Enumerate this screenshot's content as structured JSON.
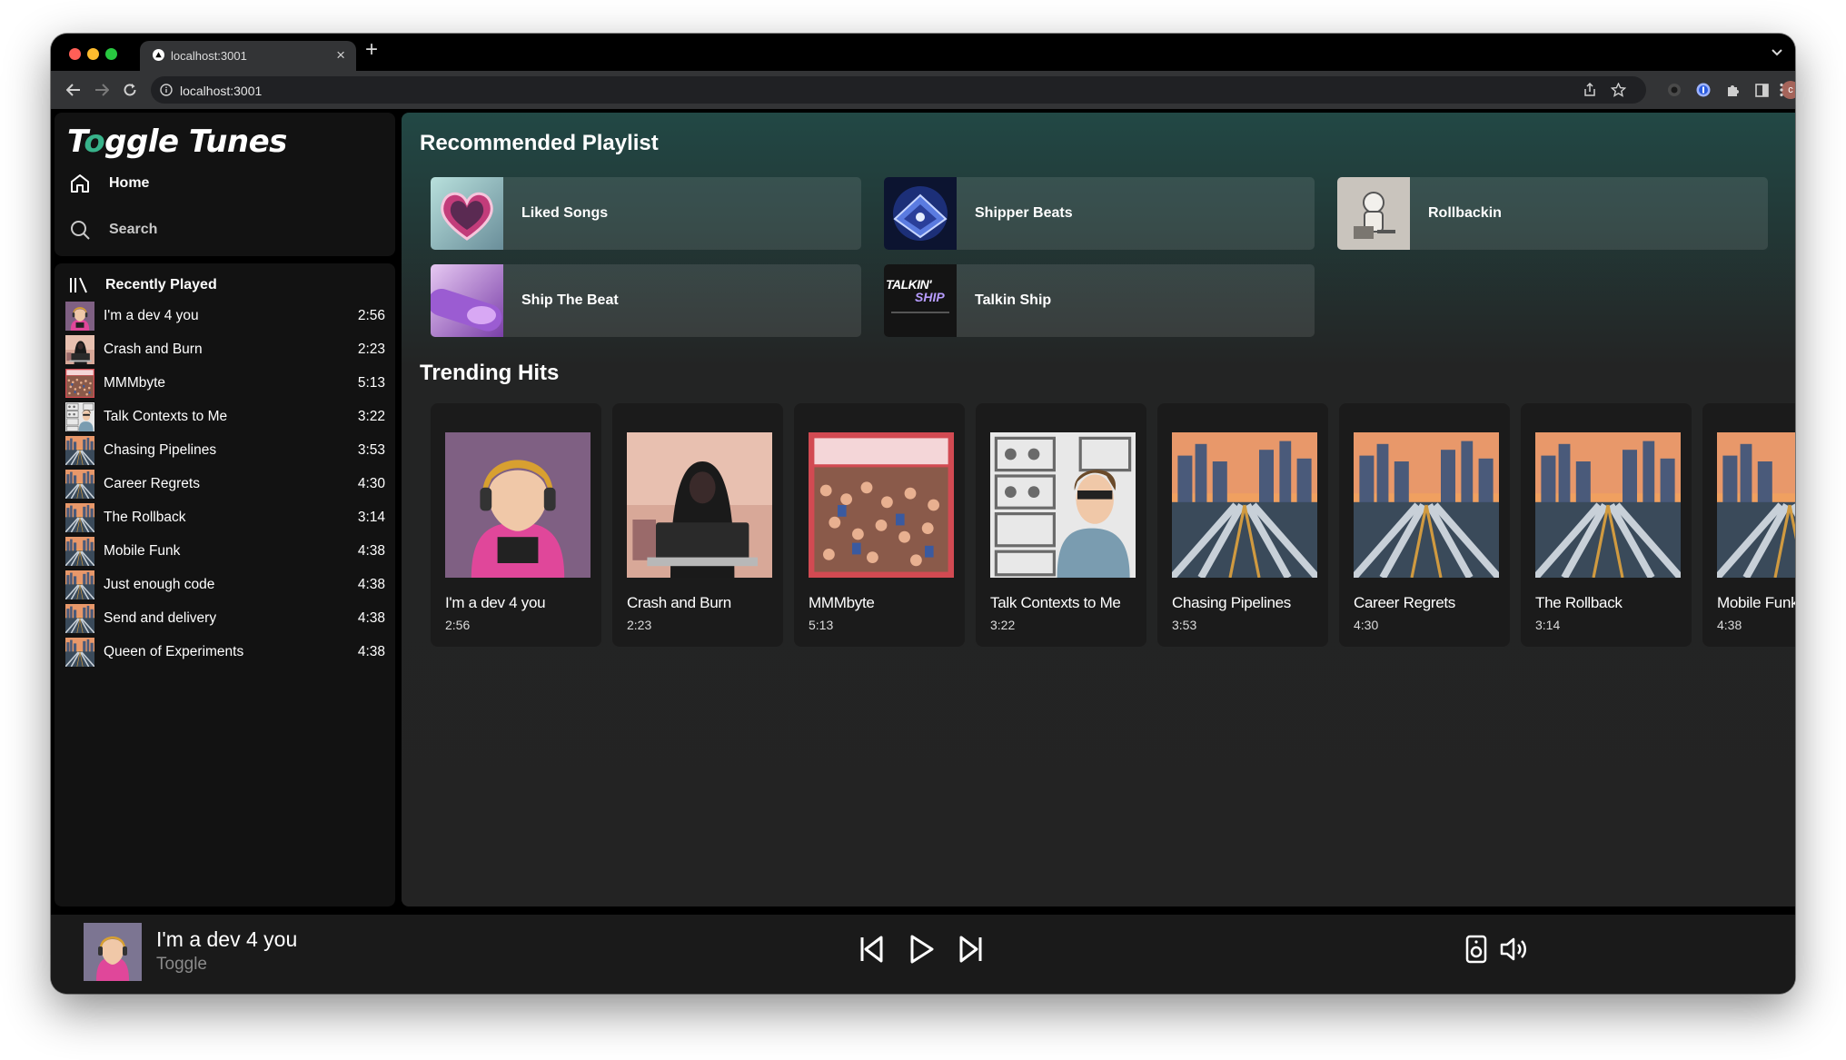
{
  "browser": {
    "tab_title": "localhost:3001",
    "url": "localhost:3001",
    "new_tab_symbol": "+",
    "close_tab_symbol": "×"
  },
  "app": {
    "logo": "Toggle Tunes",
    "nav": {
      "home": "Home",
      "search": "Search"
    },
    "recently_played": {
      "title": "Recently Played",
      "items": [
        {
          "name": "I'm a dev 4 you",
          "duration": "2:56"
        },
        {
          "name": "Crash and Burn",
          "duration": "2:23"
        },
        {
          "name": "MMMbyte",
          "duration": "5:13"
        },
        {
          "name": "Talk Contexts to Me",
          "duration": "3:22"
        },
        {
          "name": "Chasing Pipelines",
          "duration": "3:53"
        },
        {
          "name": "Career Regrets",
          "duration": "4:30"
        },
        {
          "name": "The Rollback",
          "duration": "3:14"
        },
        {
          "name": "Mobile Funk",
          "duration": "4:38"
        },
        {
          "name": "Just enough code",
          "duration": "4:38"
        },
        {
          "name": "Send and delivery",
          "duration": "4:38"
        },
        {
          "name": "Queen of Experiments",
          "duration": "4:38"
        }
      ]
    },
    "recommended": {
      "title": "Recommended Playlist",
      "playlists": [
        "Liked Songs",
        "Shipper Beats",
        "Rollbackin",
        "Ship The Beat",
        "Talkin Ship"
      ],
      "talkin_ship_art_text": [
        "TALKIN'",
        "SHIP"
      ]
    },
    "trending": {
      "title": "Trending Hits",
      "items": [
        {
          "name": "I'm a dev 4 you",
          "duration": "2:56"
        },
        {
          "name": "Crash and Burn",
          "duration": "2:23"
        },
        {
          "name": "MMMbyte",
          "duration": "5:13"
        },
        {
          "name": "Talk Contexts to Me",
          "duration": "3:22"
        },
        {
          "name": "Chasing Pipelines",
          "duration": "3:53"
        },
        {
          "name": "Career Regrets",
          "duration": "4:30"
        },
        {
          "name": "The Rollback",
          "duration": "3:14"
        },
        {
          "name": "Mobile Funk",
          "duration": "4:38"
        }
      ]
    },
    "now_playing": {
      "title": "I'm a dev 4 you",
      "artist": "Toggle"
    }
  },
  "colors": {
    "accent": "#38b28a",
    "main_gradient_top": "#224845",
    "panel": "#121212",
    "player_bar": "#1a1a1a"
  }
}
